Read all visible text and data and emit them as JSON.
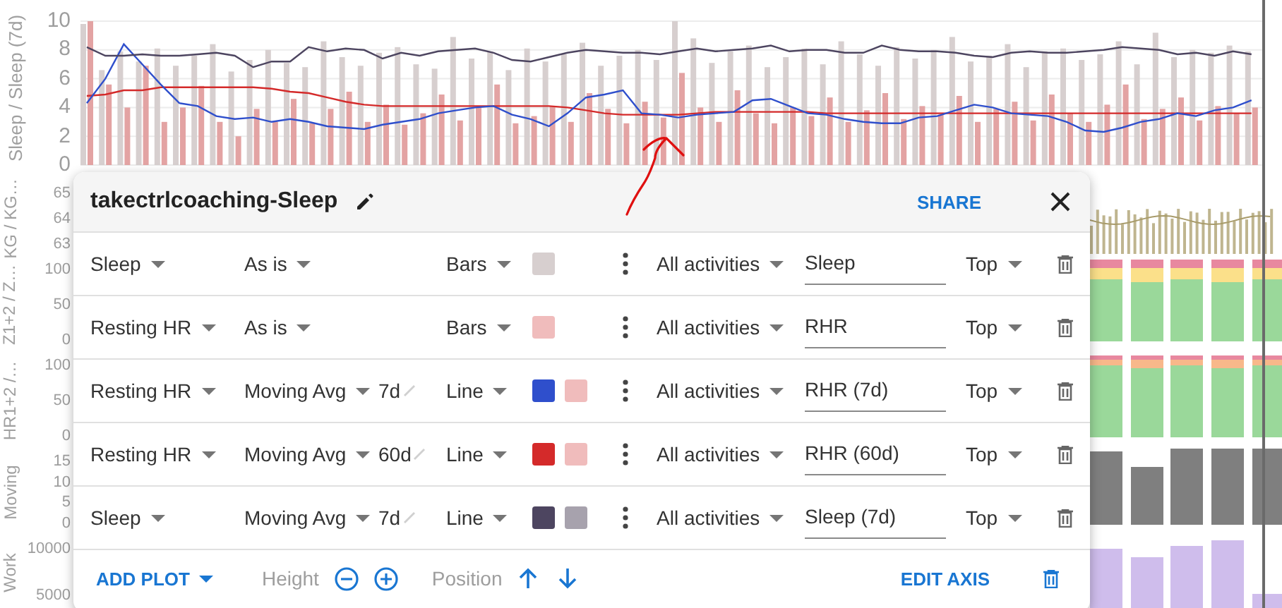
{
  "charts": {
    "main": {
      "chart_data": {
        "type": "bar",
        "grid": true,
        "ylabel": "Sleep / Sleep (7d)",
        "ylim": [
          0,
          10
        ],
        "yticks": [
          {
            "value": 10,
            "label": "10"
          },
          {
            "value": 8,
            "label": "8"
          },
          {
            "value": 6,
            "label": "6"
          },
          {
            "value": 4,
            "label": "4"
          },
          {
            "value": 2,
            "label": "2"
          },
          {
            "value": 0,
            "label": "0"
          }
        ],
        "series": [
          {
            "type": "bar",
            "color": "#d7cfcf",
            "values": [
              9.8,
              6.6,
              7.9,
              7.2,
              8.1,
              6.9,
              7.6,
              8.4,
              6.5,
              7.3,
              8.0,
              7.1,
              6.8,
              8.6,
              7.5,
              6.9,
              7.8,
              8.2,
              7.0,
              6.7,
              8.9,
              7.4,
              7.9,
              6.6,
              8.1,
              7.2,
              7.7,
              8.5,
              6.9,
              7.6,
              8.0,
              7.3,
              10.0,
              8.8,
              7.1,
              7.9,
              8.3,
              6.8,
              7.5,
              8.1,
              7.0,
              8.6,
              7.7,
              6.9,
              8.2,
              7.4,
              8.0,
              8.9,
              7.2,
              7.6,
              8.4,
              6.8,
              7.9,
              8.1,
              7.3,
              7.7,
              8.6,
              7.0,
              9.2,
              7.5,
              8.0,
              7.8,
              8.3,
              7.9
            ]
          },
          {
            "type": "bar",
            "color": "#e3a3a3",
            "values": [
              10.0,
              5.6,
              4.0,
              6.9,
              3.0,
              4.0,
              5.5,
              3.0,
              2.0,
              3.9,
              3.0,
              4.6,
              2.9,
              3.9,
              5.1,
              3.0,
              4.2,
              2.8,
              3.6,
              4.9,
              3.1,
              4.0,
              5.6,
              2.9,
              3.4,
              4.1,
              3.0,
              5.0,
              3.9,
              2.9,
              4.4,
              3.3,
              6.4,
              4.0,
              3.0,
              5.2,
              3.6,
              2.9,
              4.0,
              3.4,
              4.7,
              3.0,
              3.8,
              5.0,
              3.2,
              4.1,
              3.5,
              4.8,
              3.0,
              3.9,
              4.4,
              3.1,
              4.9,
              3.6,
              3.0,
              4.2,
              5.6,
              3.2,
              3.9,
              4.7,
              3.1,
              4.1,
              3.6,
              4.0
            ]
          },
          {
            "type": "line",
            "color": "#d42a2a",
            "values": [
              4.8,
              4.9,
              5.2,
              5.2,
              5.4,
              5.4,
              5.4,
              5.4,
              5.4,
              5.4,
              5.3,
              5.1,
              5.0,
              4.7,
              4.4,
              4.2,
              4.1,
              4.1,
              4.1,
              4.1,
              4.1,
              4.1,
              4.1,
              4.1,
              4.1,
              4.1,
              4.0,
              3.8,
              3.6,
              3.5,
              3.5,
              3.5,
              3.5,
              3.6,
              3.7,
              3.7,
              3.7,
              3.7,
              3.7,
              3.7,
              3.6,
              3.6,
              3.6,
              3.6,
              3.6,
              3.6,
              3.6,
              3.6,
              3.6,
              3.6,
              3.6,
              3.6,
              3.6,
              3.6,
              3.6,
              3.6,
              3.6,
              3.6,
              3.6,
              3.6,
              3.6,
              3.6,
              3.6,
              3.6
            ]
          },
          {
            "type": "line",
            "color": "#2f4fcc",
            "values": [
              4.3,
              6.0,
              8.4,
              7.0,
              5.6,
              4.3,
              4.1,
              3.4,
              3.2,
              3.3,
              3.0,
              3.2,
              3.0,
              2.7,
              2.6,
              2.5,
              2.8,
              3.0,
              3.2,
              3.6,
              3.8,
              4.0,
              4.1,
              3.5,
              3.2,
              2.7,
              3.6,
              4.7,
              4.9,
              5.2,
              3.6,
              3.5,
              3.3,
              3.5,
              3.6,
              3.7,
              4.5,
              4.6,
              4.1,
              3.6,
              3.5,
              3.2,
              3.0,
              2.9,
              2.9,
              3.3,
              3.4,
              3.8,
              4.2,
              4.0,
              3.6,
              3.5,
              3.4,
              3.0,
              2.4,
              2.3,
              2.6,
              3.0,
              3.2,
              3.6,
              3.4,
              3.8,
              4.0,
              4.5
            ]
          },
          {
            "type": "line",
            "color": "#4d4560",
            "values": [
              8.2,
              7.6,
              7.6,
              7.7,
              7.6,
              7.6,
              7.7,
              7.8,
              7.6,
              6.8,
              7.2,
              7.2,
              8.2,
              7.9,
              8.1,
              8.0,
              7.4,
              7.8,
              7.6,
              7.9,
              8.0,
              8.1,
              7.8,
              7.3,
              7.2,
              7.5,
              7.8,
              8.0,
              7.9,
              7.8,
              7.8,
              7.7,
              7.9,
              8.1,
              7.9,
              8.0,
              8.1,
              8.3,
              7.9,
              8.0,
              8.0,
              7.8,
              7.8,
              8.3,
              8.0,
              7.9,
              7.9,
              7.8,
              7.6,
              7.5,
              7.8,
              7.9,
              7.8,
              7.8,
              7.9,
              8.0,
              8.2,
              8.1,
              8.0,
              7.7,
              7.8,
              7.6,
              7.9,
              7.7
            ]
          }
        ]
      }
    },
    "axes": [
      {
        "label": "KG / KG…",
        "ticks": [
          "65",
          "64",
          "63"
        ]
      },
      {
        "label": "Z1+2 / Z…",
        "ticks": [
          "100",
          "50",
          "0"
        ]
      },
      {
        "label": "HR1+2 /…",
        "ticks": [
          "100",
          "50",
          "0"
        ]
      },
      {
        "label": "Moving",
        "ticks": [
          "15",
          "10",
          "5",
          "0"
        ]
      },
      {
        "label": "Work",
        "ticks": [
          "10000",
          "5000"
        ]
      }
    ]
  },
  "dialog": {
    "title": "takectrlcoaching-Sleep",
    "share": "SHARE",
    "plots": [
      {
        "metric": "Sleep",
        "mode": "As is",
        "type": "Bars",
        "swatches": [
          {
            "color": "#d7cfcf"
          }
        ],
        "filter": "All activities",
        "label": "Sleep",
        "position": "Top"
      },
      {
        "metric": "Resting HR",
        "mode": "As is",
        "type": "Bars",
        "swatches": [
          {
            "color": "#f0bcbc"
          }
        ],
        "filter": "All activities",
        "label": "RHR",
        "position": "Top"
      },
      {
        "metric": "Resting HR",
        "mode": "Moving Avg",
        "window": "7d",
        "type": "Line",
        "swatches": [
          {
            "color": "#2f4fcc"
          },
          {
            "color": "#f0bcbc"
          }
        ],
        "filter": "All activities",
        "label": "RHR (7d)",
        "position": "Top"
      },
      {
        "metric": "Resting HR",
        "mode": "Moving Avg",
        "window": "60d",
        "type": "Line",
        "swatches": [
          {
            "color": "#d42a2a"
          },
          {
            "color": "#f0bcbc"
          }
        ],
        "filter": "All activities",
        "label": "RHR (60d)",
        "position": "Top"
      },
      {
        "metric": "Sleep",
        "mode": "Moving Avg",
        "window": "7d",
        "type": "Line",
        "swatches": [
          {
            "color": "#4d4560"
          },
          {
            "color": "#a7a2ad"
          }
        ],
        "filter": "All activities",
        "label": "Sleep (7d)",
        "position": "Top"
      }
    ],
    "footer": {
      "add_plot": "ADD PLOT",
      "height": "Height",
      "position": "Position",
      "edit_axis": "EDIT AXIS"
    }
  }
}
